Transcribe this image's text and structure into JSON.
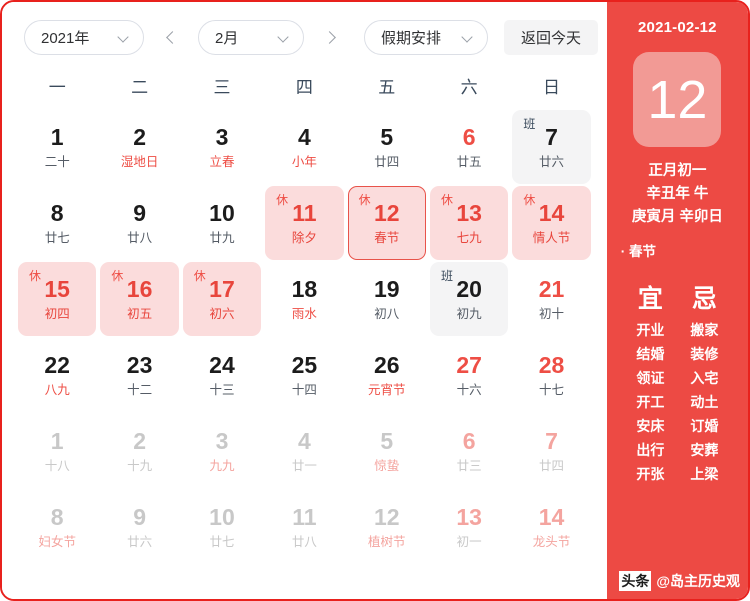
{
  "toolbar": {
    "year_label": "2021年",
    "prev_icon": "chevron-left-icon",
    "month_label": "2月",
    "next_icon": "chevron-right-icon",
    "holiday_label": "假期安排",
    "today_label": "返回今天"
  },
  "weekdays": [
    "一",
    "二",
    "三",
    "四",
    "五",
    "六",
    "日"
  ],
  "weeks": [
    [
      {
        "num": "1",
        "lunar": "二十",
        "numRed": false,
        "lunarRed": false,
        "badge": "",
        "state": ""
      },
      {
        "num": "2",
        "lunar": "湿地日",
        "numRed": false,
        "lunarRed": true,
        "badge": "",
        "state": ""
      },
      {
        "num": "3",
        "lunar": "立春",
        "numRed": false,
        "lunarRed": true,
        "badge": "",
        "state": ""
      },
      {
        "num": "4",
        "lunar": "小年",
        "numRed": false,
        "lunarRed": true,
        "badge": "",
        "state": ""
      },
      {
        "num": "5",
        "lunar": "廿四",
        "numRed": false,
        "lunarRed": false,
        "badge": "",
        "state": ""
      },
      {
        "num": "6",
        "lunar": "廿五",
        "numRed": true,
        "lunarRed": false,
        "badge": "",
        "state": ""
      },
      {
        "num": "7",
        "lunar": "廿六",
        "numRed": false,
        "lunarRed": false,
        "badge": "班",
        "state": "work"
      }
    ],
    [
      {
        "num": "8",
        "lunar": "廿七",
        "numRed": false,
        "lunarRed": false,
        "badge": "",
        "state": ""
      },
      {
        "num": "9",
        "lunar": "廿八",
        "numRed": false,
        "lunarRed": false,
        "badge": "",
        "state": ""
      },
      {
        "num": "10",
        "lunar": "廿九",
        "numRed": false,
        "lunarRed": false,
        "badge": "",
        "state": ""
      },
      {
        "num": "11",
        "lunar": "除夕",
        "numRed": false,
        "lunarRed": false,
        "badge": "休",
        "state": "rest"
      },
      {
        "num": "12",
        "lunar": "春节",
        "numRed": false,
        "lunarRed": false,
        "badge": "休",
        "state": "selected"
      },
      {
        "num": "13",
        "lunar": "七九",
        "numRed": false,
        "lunarRed": false,
        "badge": "休",
        "state": "rest"
      },
      {
        "num": "14",
        "lunar": "情人节",
        "numRed": false,
        "lunarRed": false,
        "badge": "休",
        "state": "rest"
      }
    ],
    [
      {
        "num": "15",
        "lunar": "初四",
        "numRed": false,
        "lunarRed": false,
        "badge": "休",
        "state": "rest"
      },
      {
        "num": "16",
        "lunar": "初五",
        "numRed": false,
        "lunarRed": false,
        "badge": "休",
        "state": "rest"
      },
      {
        "num": "17",
        "lunar": "初六",
        "numRed": false,
        "lunarRed": false,
        "badge": "休",
        "state": "rest"
      },
      {
        "num": "18",
        "lunar": "雨水",
        "numRed": false,
        "lunarRed": true,
        "badge": "",
        "state": ""
      },
      {
        "num": "19",
        "lunar": "初八",
        "numRed": false,
        "lunarRed": false,
        "badge": "",
        "state": ""
      },
      {
        "num": "20",
        "lunar": "初九",
        "numRed": false,
        "lunarRed": false,
        "badge": "班",
        "state": "work"
      },
      {
        "num": "21",
        "lunar": "初十",
        "numRed": true,
        "lunarRed": false,
        "badge": "",
        "state": ""
      }
    ],
    [
      {
        "num": "22",
        "lunar": "八九",
        "numRed": false,
        "lunarRed": true,
        "badge": "",
        "state": ""
      },
      {
        "num": "23",
        "lunar": "十二",
        "numRed": false,
        "lunarRed": false,
        "badge": "",
        "state": ""
      },
      {
        "num": "24",
        "lunar": "十三",
        "numRed": false,
        "lunarRed": false,
        "badge": "",
        "state": ""
      },
      {
        "num": "25",
        "lunar": "十四",
        "numRed": false,
        "lunarRed": false,
        "badge": "",
        "state": ""
      },
      {
        "num": "26",
        "lunar": "元宵节",
        "numRed": false,
        "lunarRed": true,
        "badge": "",
        "state": ""
      },
      {
        "num": "27",
        "lunar": "十六",
        "numRed": true,
        "lunarRed": false,
        "badge": "",
        "state": ""
      },
      {
        "num": "28",
        "lunar": "十七",
        "numRed": true,
        "lunarRed": false,
        "badge": "",
        "state": ""
      }
    ],
    [
      {
        "num": "1",
        "lunar": "十八",
        "numRed": false,
        "lunarRed": false,
        "badge": "",
        "state": "other"
      },
      {
        "num": "2",
        "lunar": "十九",
        "numRed": false,
        "lunarRed": false,
        "badge": "",
        "state": "other"
      },
      {
        "num": "3",
        "lunar": "九九",
        "numRed": false,
        "lunarRed": true,
        "badge": "",
        "state": "other"
      },
      {
        "num": "4",
        "lunar": "廿一",
        "numRed": false,
        "lunarRed": false,
        "badge": "",
        "state": "other"
      },
      {
        "num": "5",
        "lunar": "惊蛰",
        "numRed": false,
        "lunarRed": true,
        "badge": "",
        "state": "other"
      },
      {
        "num": "6",
        "lunar": "廿三",
        "numRed": true,
        "lunarRed": false,
        "badge": "",
        "state": "other"
      },
      {
        "num": "7",
        "lunar": "廿四",
        "numRed": true,
        "lunarRed": false,
        "badge": "",
        "state": "other"
      }
    ],
    [
      {
        "num": "8",
        "lunar": "妇女节",
        "numRed": false,
        "lunarRed": true,
        "badge": "",
        "state": "other"
      },
      {
        "num": "9",
        "lunar": "廿六",
        "numRed": false,
        "lunarRed": false,
        "badge": "",
        "state": "other"
      },
      {
        "num": "10",
        "lunar": "廿七",
        "numRed": false,
        "lunarRed": false,
        "badge": "",
        "state": "other"
      },
      {
        "num": "11",
        "lunar": "廿八",
        "numRed": false,
        "lunarRed": false,
        "badge": "",
        "state": "other"
      },
      {
        "num": "12",
        "lunar": "植树节",
        "numRed": false,
        "lunarRed": true,
        "badge": "",
        "state": "other"
      },
      {
        "num": "13",
        "lunar": "初一",
        "numRed": true,
        "lunarRed": false,
        "badge": "",
        "state": "other"
      },
      {
        "num": "14",
        "lunar": "龙头节",
        "numRed": true,
        "lunarRed": true,
        "badge": "",
        "state": "other"
      }
    ]
  ],
  "detail": {
    "date": "2021-02-12",
    "big_day": "12",
    "lunar_line1": "正月初一",
    "lunar_line2": "辛丑年 牛",
    "lunar_line3": "庚寅月 辛卯日",
    "festival": "· 春节",
    "yi_head": "宜",
    "yi_items": [
      "开业",
      "结婚",
      "领证",
      "开工",
      "安床",
      "出行",
      "开张"
    ],
    "ji_head": "忌",
    "ji_items": [
      "搬家",
      "装修",
      "入宅",
      "动土",
      "订婚",
      "安葬",
      "上梁"
    ]
  },
  "watermark": {
    "logo": "头条",
    "name": "@岛主历史观"
  },
  "colors": {
    "brand_red": "#ed4a44",
    "border_red": "#e8211d",
    "rest_bg": "#fbdcdc",
    "work_bg": "#f4f4f5",
    "tile_pink": "#f29a95"
  }
}
